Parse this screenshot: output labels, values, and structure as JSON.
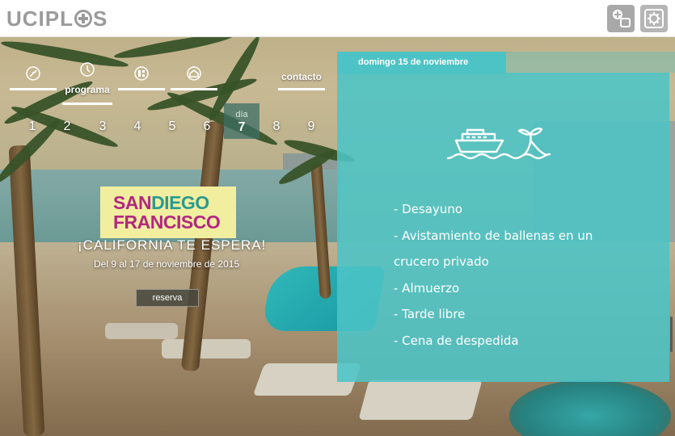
{
  "header": {
    "logo_text": "UCIPLUS",
    "buttons": [
      {
        "name": "add-user-icon"
      },
      {
        "name": "settings-icon"
      }
    ]
  },
  "nav": {
    "items": [
      {
        "icon": "leaf-icon",
        "label": ""
      },
      {
        "icon": "clock-icon",
        "label": "programa",
        "active": true
      },
      {
        "icon": "grid-icon",
        "label": ""
      },
      {
        "icon": "home-icon",
        "label": ""
      },
      {
        "icon": "",
        "label": "contacto"
      }
    ]
  },
  "days": {
    "list": [
      "1",
      "2",
      "3",
      "4",
      "5",
      "6",
      "7",
      "8",
      "9"
    ],
    "active_prefix": "día",
    "active": "7"
  },
  "promo": {
    "line1_a": "SAN",
    "line1_b": "DIEGO",
    "line2": "FRANCISCO",
    "tagline": "¡CALIFORNIA TE ESPERA!",
    "dates": "Del 9 al 17 de noviembre de 2015",
    "button": "reserva"
  },
  "panel": {
    "date_label": "domingo 15 de noviembre",
    "illustration": "boat-whale-icon",
    "items": [
      "- Desayuno",
      "- Avistamiento de ballenas en un",
      "crucero privado",
      "- Almuerzo",
      "- Tarde libre",
      "- Cena de despedida"
    ]
  },
  "colors": {
    "accent": "#4ec3c5",
    "promo_bg": "#f2eea0",
    "promo_magenta": "#b1287f",
    "promo_teal": "#2a9a8e"
  }
}
